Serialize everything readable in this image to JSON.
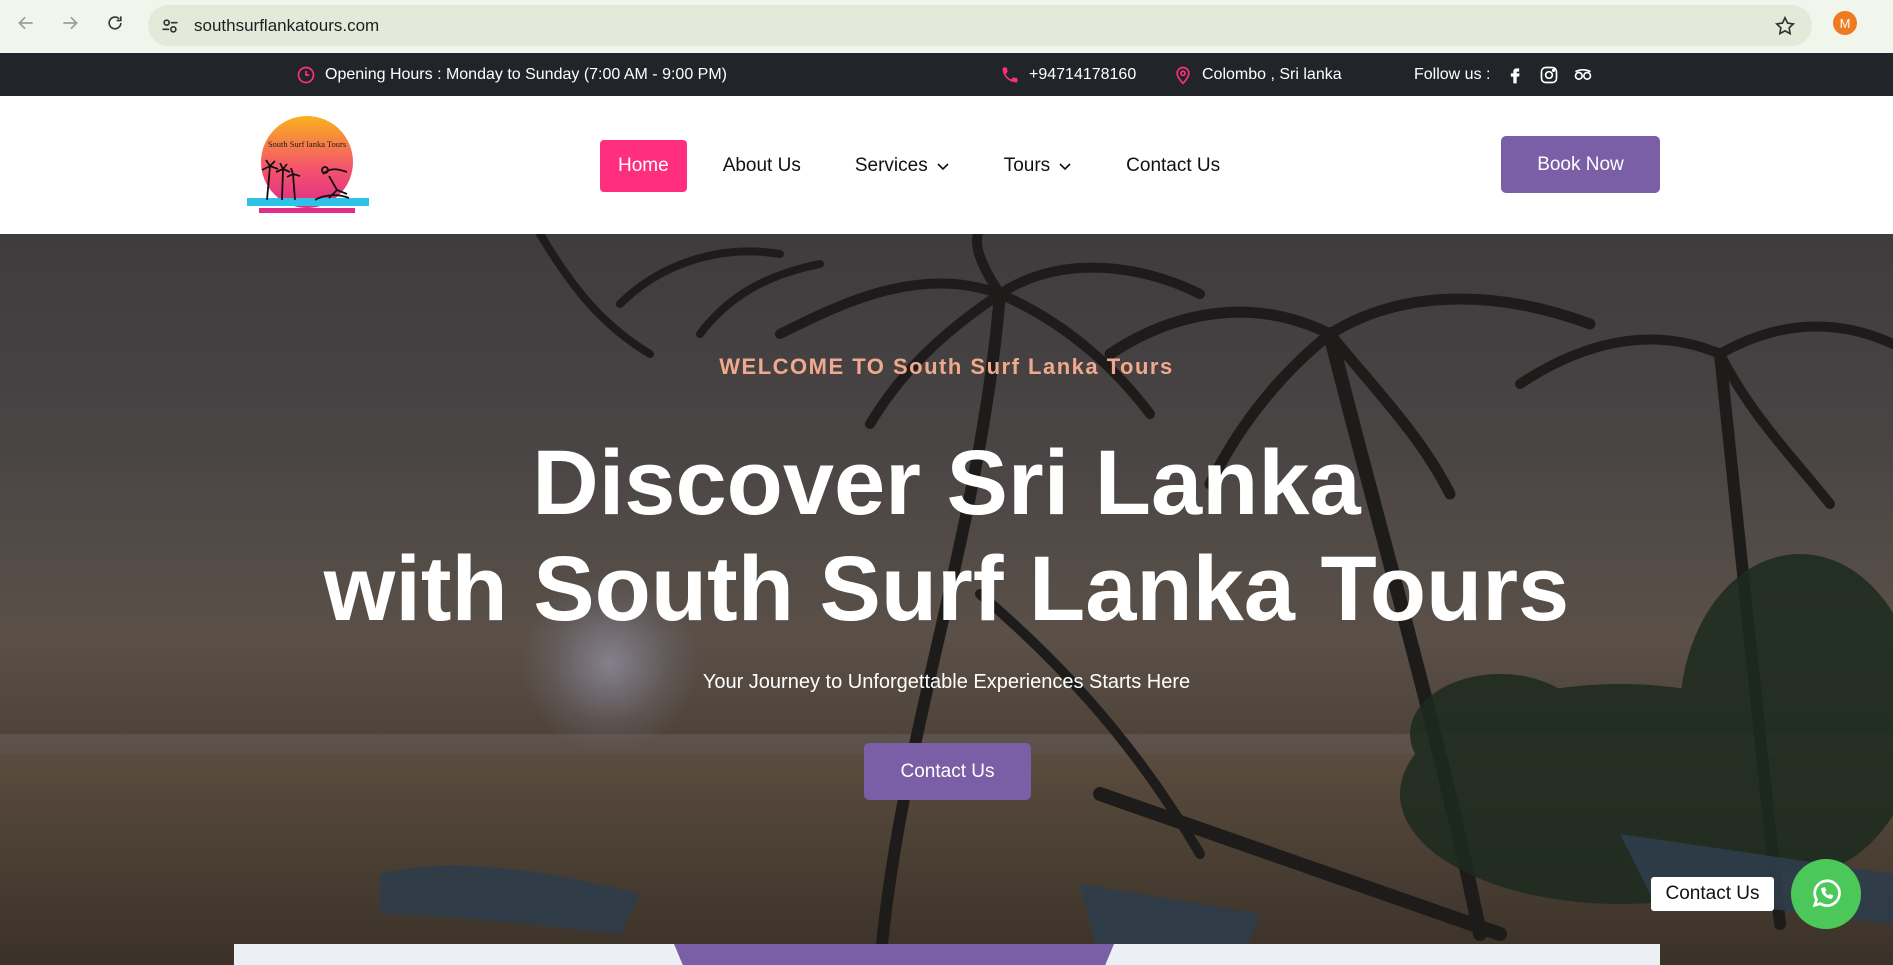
{
  "browser": {
    "url": "southsurflankatours.com",
    "profile_initial": "M"
  },
  "topbar": {
    "hours": "Opening Hours : Monday to Sunday (7:00 AM - 9:00 PM)",
    "phone": "+94714178160",
    "location": "Colombo , Sri lanka",
    "follow_label": "Follow us :",
    "social_icons": [
      "facebook-icon",
      "instagram-icon",
      "tripadvisor-icon"
    ]
  },
  "logo": {
    "text": "South Surf lanka Tours"
  },
  "nav": {
    "items": [
      {
        "label": "Home",
        "active": true
      },
      {
        "label": "About Us"
      },
      {
        "label": "Services",
        "dropdown": true
      },
      {
        "label": "Tours",
        "dropdown": true
      },
      {
        "label": "Contact Us"
      }
    ],
    "book_label": "Book Now"
  },
  "hero": {
    "welcome": "WELCOME TO South Surf Lanka Tours",
    "headline_line1": "Discover Sri Lanka",
    "headline_line2": "with South Surf Lanka Tours",
    "subline": "Your Journey to Unforgettable Experiences Starts Here",
    "cta_label": "Contact Us"
  },
  "whatsapp": {
    "label": "Contact Us"
  },
  "colors": {
    "accent_pink": "#ff2e7e",
    "accent_purple": "#7a5ea6",
    "topbar_bg": "#21252a",
    "whatsapp_green": "#4cc85a"
  }
}
